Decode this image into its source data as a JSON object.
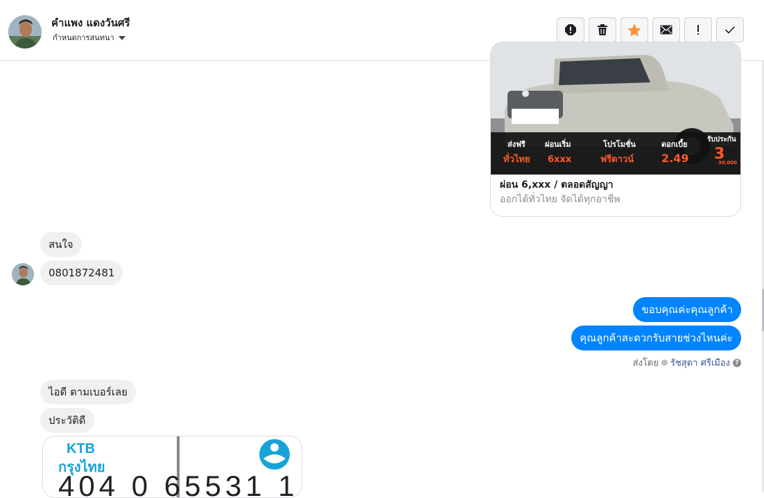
{
  "header": {
    "contact_name": "คำแพง แดงวันศรี",
    "assign_label": "กำหนดการสนทนา"
  },
  "toolbar": {
    "buttons": [
      "spam-icon",
      "trash-icon",
      "star-icon",
      "envelope-icon",
      "exclamation-icon",
      "check-icon"
    ],
    "star_color": "#f7923a"
  },
  "car_card": {
    "promo": {
      "p1_label": "ส่งฟรี",
      "p1_value": "ทั่วไทย",
      "p2_label": "ผ่อนเริ่ม",
      "p2_value": "6xxx",
      "p3_label": "โปรโมชั่น",
      "p3_value": "ฟรีดาวน์",
      "p4_label": "ดอกเบี้ย",
      "p4_value": "2.49",
      "p5_label": "รับประกัน",
      "p5_value": "3",
      "p5_sub": "30,000"
    },
    "title": "ผ่อน 6,xxx / ตลอดสัญญา",
    "subtitle": "ออกได้ทั่วไทย จัดได้ทุกอาชีพ"
  },
  "messages": {
    "in1": "สนใจ",
    "in2": "0801872481",
    "out1": "ขอบคุณค่ะคุณลูกค้า",
    "out2": "คุณลูกค้าสะดวกรับสายช่วงไหนค่ะ",
    "in3": "ไอดี  ตามเบอร์เลย",
    "in4": "ประวัติดี"
  },
  "sent_by": {
    "label": "ส่งโดย",
    "name": "รัชสุดา ศรีเมือง"
  },
  "bank_card": {
    "logo_en": "KTB",
    "logo_th": "กรุงไทย",
    "number": "404  0  65531  1"
  },
  "colors": {
    "outgoing_bubble": "#0084ff",
    "incoming_bubble": "#f0f0f0",
    "ktb_blue": "#17a3d8"
  }
}
